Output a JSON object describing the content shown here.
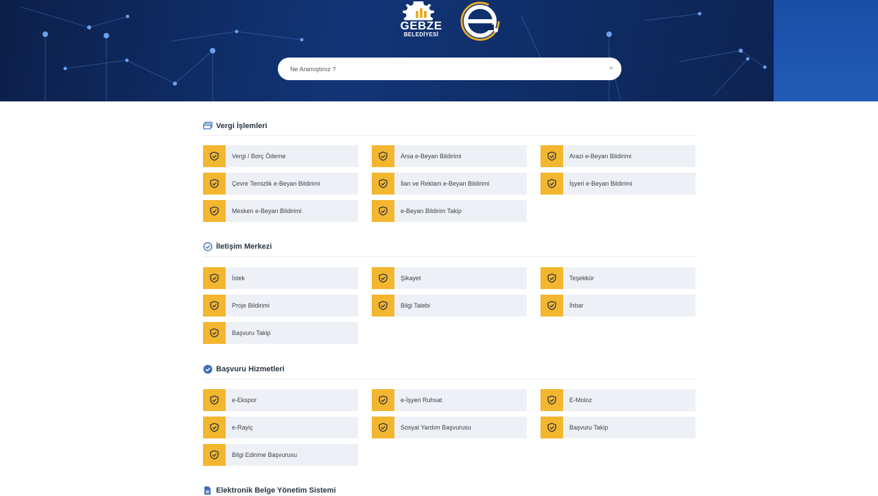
{
  "header": {
    "logo_text_1": "GEBZE",
    "logo_text_2": "BELEDİYESİ",
    "search_placeholder": "Ne Aramıştınız ?"
  },
  "colors": {
    "header_dark": "#0c1f4a",
    "header_accent": "#225bb7",
    "tile_bg": "#edf1f6",
    "tile_icon_bg": "#f3b62f",
    "e_logo_gold": "#e4ac2a"
  },
  "sections": [
    {
      "title": "Vergi İşlemleri",
      "icon": "cards-icon",
      "items": [
        {
          "label": "Vergi / Borç Ödeme",
          "icon": "shield-check-icon"
        },
        {
          "label": "Arsa e-Beyan Bildirimi",
          "icon": "shield-check-icon"
        },
        {
          "label": "Arazi e-Beyan Bildirimi",
          "icon": "shield-check-icon"
        },
        {
          "label": "Çevre Temizlik e-Beyan Bildirimi",
          "icon": "shield-check-icon"
        },
        {
          "label": "İlan ve Reklam e-Beyan Bildirimi",
          "icon": "shield-check-icon"
        },
        {
          "label": "İşyeri e-Beyan Bildirimi",
          "icon": "shield-check-icon"
        },
        {
          "label": "Mesken e-Beyan Bildirimi",
          "icon": "shield-check-icon"
        },
        {
          "label": "e-Beyan Bildirim Takip",
          "icon": "shield-check-icon"
        }
      ]
    },
    {
      "title": "İletişim Merkezi",
      "icon": "check-circle-outline-icon",
      "items": [
        {
          "label": "İstek",
          "icon": "shield-check-icon"
        },
        {
          "label": "Şikayet",
          "icon": "shield-check-icon"
        },
        {
          "label": "Teşekkür",
          "icon": "shield-check-icon"
        },
        {
          "label": "Proje Bildirimi",
          "icon": "shield-check-icon"
        },
        {
          "label": "Bilgi Talebi",
          "icon": "shield-check-icon"
        },
        {
          "label": "İhbar",
          "icon": "shield-check-icon"
        },
        {
          "label": "Başvuru Takip",
          "icon": "shield-check-icon"
        }
      ]
    },
    {
      "title": "Başvuru Hizmetleri",
      "icon": "check-circle-filled-icon",
      "items": [
        {
          "label": "e-Ekspor",
          "icon": "shield-check-icon"
        },
        {
          "label": "e-İşyeri Ruhsat",
          "icon": "shield-check-icon"
        },
        {
          "label": "E-Moloz",
          "icon": "shield-check-icon"
        },
        {
          "label": "e-Rayiç",
          "icon": "shield-check-icon"
        },
        {
          "label": "Sosyal Yardım Başvurusu",
          "icon": "shield-check-icon"
        },
        {
          "label": "Başvuru Takip",
          "icon": "shield-check-icon"
        },
        {
          "label": "Bilgi Edinme Başvurusu",
          "icon": "shield-check-icon"
        }
      ]
    },
    {
      "title": "Elektronik Belge Yönetim Sistemi",
      "icon": "document-icon",
      "items": []
    }
  ]
}
